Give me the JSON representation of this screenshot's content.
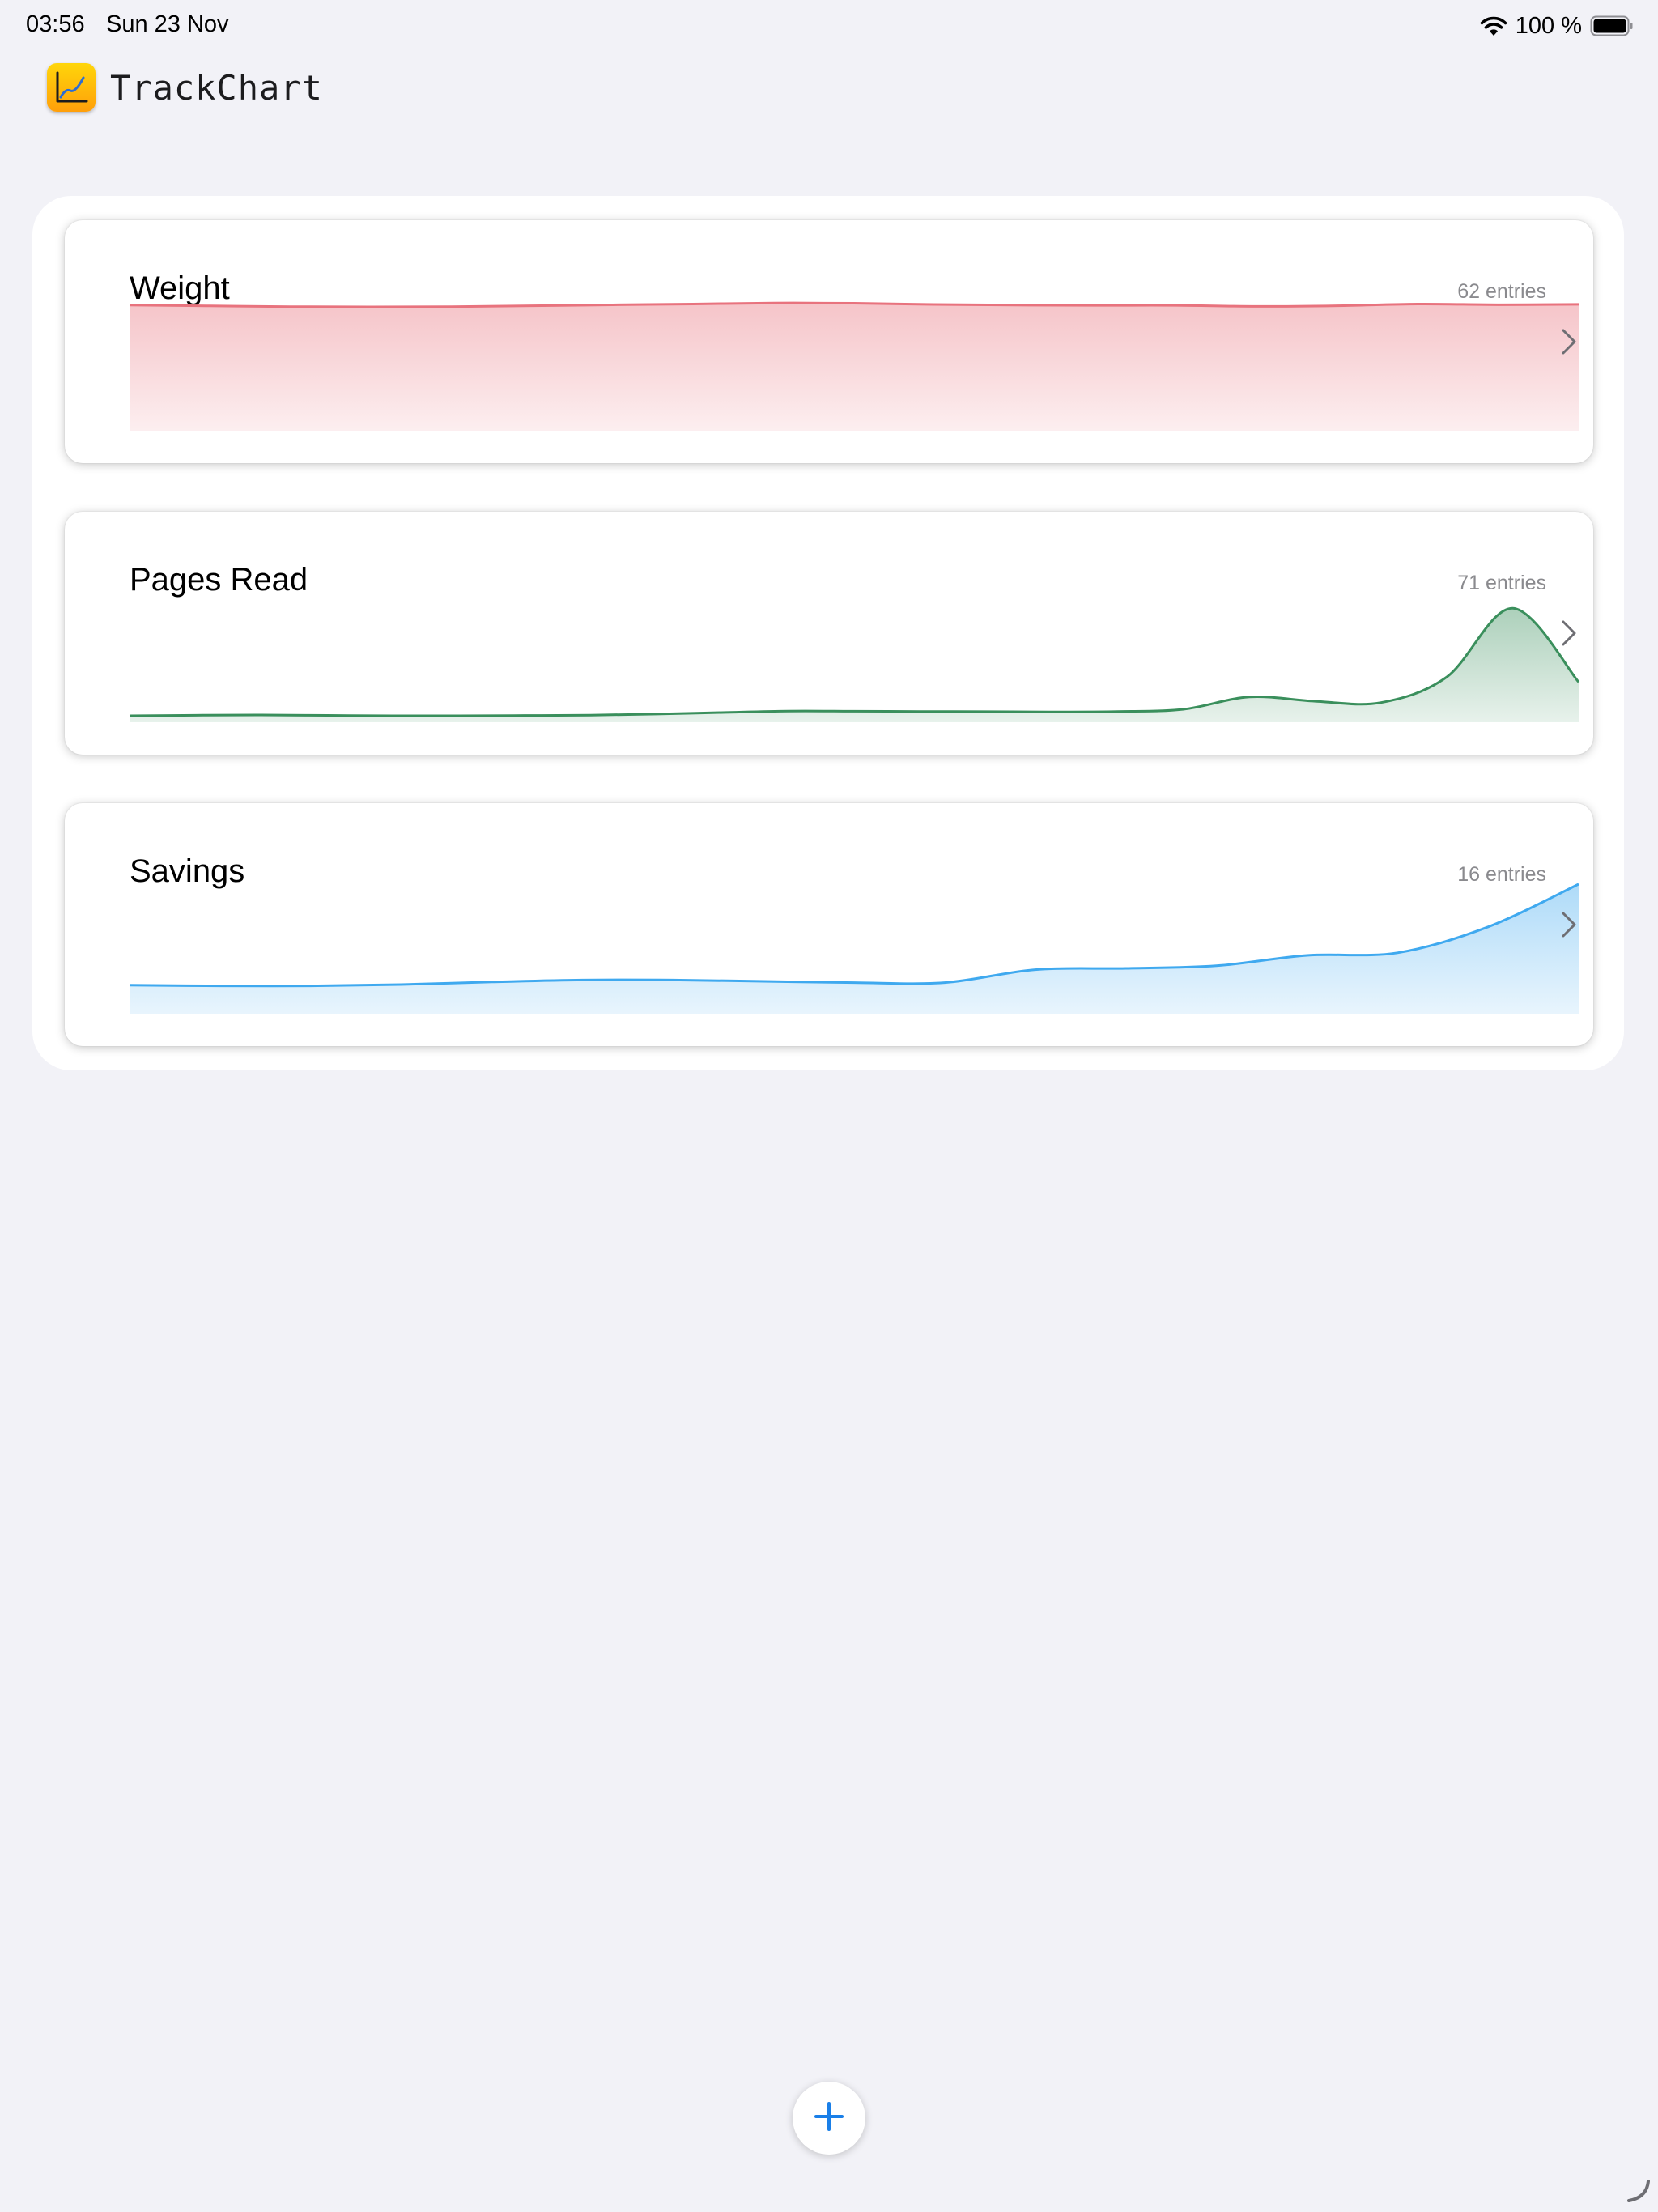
{
  "status_bar": {
    "time": "03:56",
    "date": "Sun 23 Nov",
    "battery_percent": "100 %",
    "wifi_icon": "wifi-icon",
    "battery_icon": "battery-full-icon"
  },
  "app": {
    "title": "TrackChart",
    "icon": "line-chart-icon",
    "icon_color": "#ffb300"
  },
  "trackers": [
    {
      "title": "Weight",
      "entries_label": "62 entries",
      "chevron_icon": "chevron-right-icon",
      "color": "#e8737e",
      "chart_data": {
        "type": "area",
        "series": [
          {
            "values": [
              97.0,
              96.4,
              95.8,
              95.6,
              95.8,
              96.5,
              97.2,
              97.8,
              98.6,
              98.4,
              97.5,
              97.0,
              96.8,
              96.8,
              96.0,
              96.5,
              97.8,
              97.3,
              97.6
            ]
          }
        ],
        "ylim": [
          0,
          100
        ]
      }
    },
    {
      "title": "Pages Read",
      "entries_label": "71 entries",
      "chevron_icon": "chevron-right-icon",
      "color": "#3a8f5c",
      "chart_data": {
        "type": "area",
        "series": [
          {
            "values": [
              5.0,
              5.4,
              5.6,
              5.3,
              5.0,
              5.0,
              5.2,
              5.5,
              6.3,
              7.5,
              8.6,
              8.5,
              8.3,
              8.2,
              8.0,
              8.3,
              10.0,
              19.5,
              16.2,
              15.2,
              35.0,
              88.0,
              31.0
            ]
          }
        ],
        "ylim": [
          0,
          100
        ]
      }
    },
    {
      "title": "Savings",
      "entries_label": "16 entries",
      "chevron_icon": "chevron-right-icon",
      "color": "#3fa9ef",
      "chart_data": {
        "type": "area",
        "series": [
          {
            "values": [
              22,
              21.5,
              21.5,
              22.5,
              24.5,
              26,
              26,
              25,
              24,
              24,
              34,
              35,
              37,
              45,
              47,
              67,
              100
            ]
          }
        ],
        "ylim": [
          0,
          100
        ]
      }
    }
  ],
  "add_button": {
    "icon": "plus-icon"
  }
}
